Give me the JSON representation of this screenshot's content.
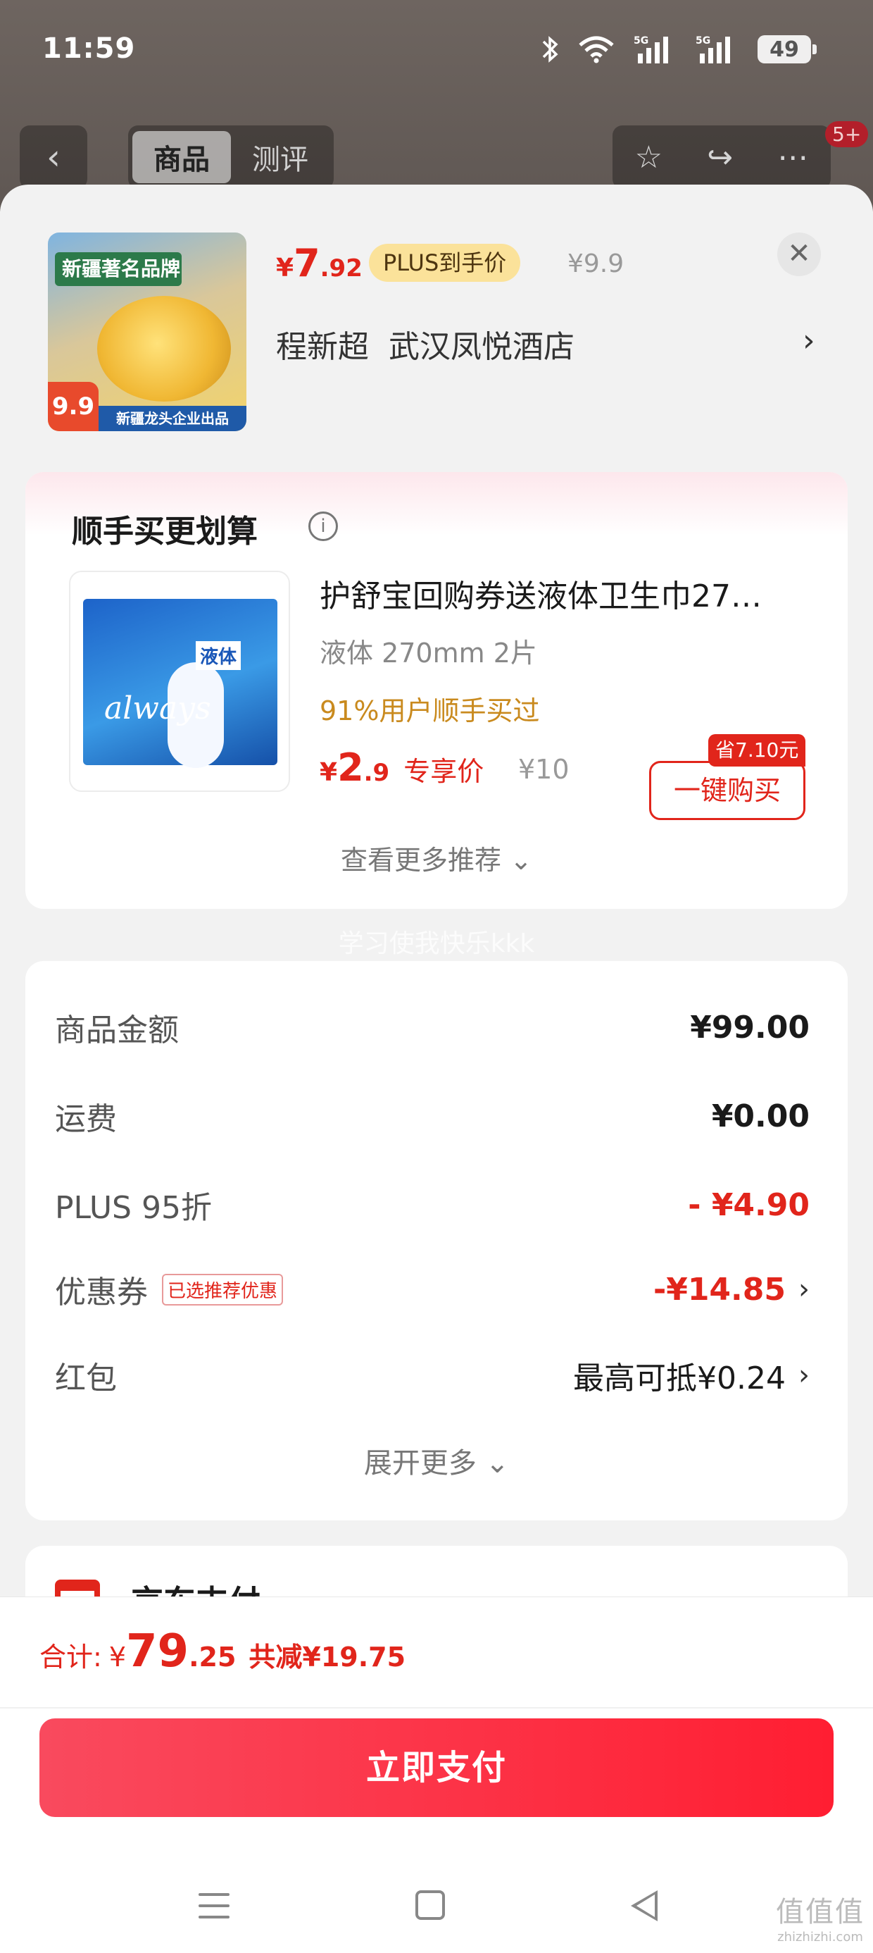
{
  "status_bar": {
    "time": "11:59",
    "battery": "49"
  },
  "background_nav": {
    "back_icon": "chevron-left-icon",
    "tabs": [
      {
        "label": "商品",
        "active": true
      },
      {
        "label": "测评",
        "active": false
      }
    ],
    "badge": "5+"
  },
  "product": {
    "thumb_top_text": "新疆著名品牌",
    "thumb_price": "9.9",
    "thumb_bottom_text": "新疆龙头企业出品",
    "price_symbol": "¥",
    "price_int": "7",
    "price_dec": ".92",
    "plus_label": "PLUS到手价",
    "original_price": "¥9.9",
    "address": "程新超  武汉凤悦酒店"
  },
  "recommend": {
    "title": "顺手买更划算",
    "pack_brand": "always",
    "pack_label": "液体",
    "item_name": "护舒宝回购券送液体卫生巾27…",
    "spec": "液体 270mm 2片",
    "bought_text": "91%用户顺手买过",
    "price_symbol": "¥",
    "price_int": "2",
    "price_dec": ".9",
    "price_label": "专享价",
    "original_price": "¥10",
    "save_tag": "省7.10元",
    "buy_button": "一键购买",
    "more_text": "查看更多推荐 ⌄"
  },
  "watermark": "学习使我快乐kkk",
  "details": {
    "rows": [
      {
        "label": "商品金额",
        "value": "¥99.00"
      },
      {
        "label": "运费",
        "value": "¥0.00"
      },
      {
        "label": "PLUS 95折",
        "value": "- ¥4.90"
      },
      {
        "label": "优惠券",
        "tag": "已选推荐优惠",
        "value": "-¥14.85"
      },
      {
        "label": "红包",
        "value": "最高可抵¥0.24"
      }
    ],
    "expand_text": "展开更多 ⌄"
  },
  "payment": {
    "method": "京东支付"
  },
  "footer": {
    "total_label": "合计:",
    "total_symbol": "¥",
    "total_int": "79",
    "total_dec": ".25",
    "total_cut": "共减¥19.75",
    "pay_button": "立即支付"
  },
  "site_mark": {
    "big": "值值值",
    "small": "zhizhizhi.com"
  },
  "colors": {
    "accent_red": "#e1251b",
    "plus_gold": "#fbe29a",
    "bought_gold": "#c98a1e"
  }
}
